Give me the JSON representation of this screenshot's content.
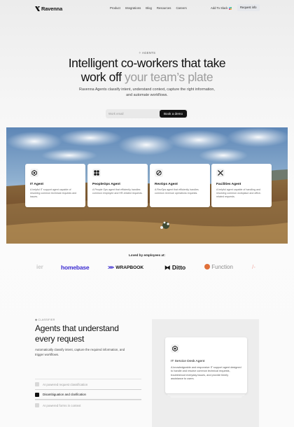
{
  "nav": {
    "brand": "Ravenna",
    "links": [
      "Product",
      "Integrations",
      "Blog",
      "Resources",
      "Careers"
    ],
    "add_to_slack": "Add To Slack",
    "request_info": "Request info"
  },
  "hero": {
    "badge": "AGENTS",
    "title_line1": "Intelligent co-workers that take",
    "title_line2_strong": "work off",
    "title_line2_muted": "your team’s plate",
    "subtitle": "Ravenna Agents classify intent, understand context, capture the right information, and automate workflows.",
    "email_placeholder": "Work email",
    "cta": "Book a demo"
  },
  "agents": [
    {
      "title": "IT Agent",
      "desc": "A helpful IT support agent capable of resolving common technical requests and issues.",
      "icon": "it-agent-icon"
    },
    {
      "title": "PeopleOps Agent",
      "desc": "A People Ops agent that efficiently handles common employee and HR-related requests.",
      "icon": "peopleops-agent-icon"
    },
    {
      "title": "RevOps Agent",
      "desc": "A RevOps agent that efficiently handles common revenue operations requests.",
      "icon": "revops-agent-icon"
    },
    {
      "title": "Facilities Agent",
      "desc": "A helpful agent capable of handling and resolving common workplace and office-related requests.",
      "icon": "facilities-agent-icon"
    }
  ],
  "logos": {
    "heading": "Loved by employees at:",
    "items": [
      "ier",
      "homebase",
      "WRAPBOOK",
      "Ditto",
      "Function"
    ]
  },
  "features": {
    "kicker": "CLASSIFIER",
    "title": "Agents that understand every request",
    "subtitle": "Automatically classify intent, capture the required information, and trigger workflows.",
    "items": [
      {
        "label": "AI powered request classification",
        "active": false
      },
      {
        "label": "Disambiguation and clarification",
        "active": true
      },
      {
        "label": "AI powered forms in context",
        "active": false
      }
    ],
    "mock_card": {
      "title": "IT Service Desk Agent",
      "desc": "A knowledgeable and responsive IT support agent designed to handle and resolve common technical requests, troubleshoot everyday issues, and provide timely assistance to users."
    }
  },
  "colors": {
    "cta_bg": "#131313",
    "accent_purple": "#3b2bd1",
    "function_orange": "#e0703a"
  }
}
